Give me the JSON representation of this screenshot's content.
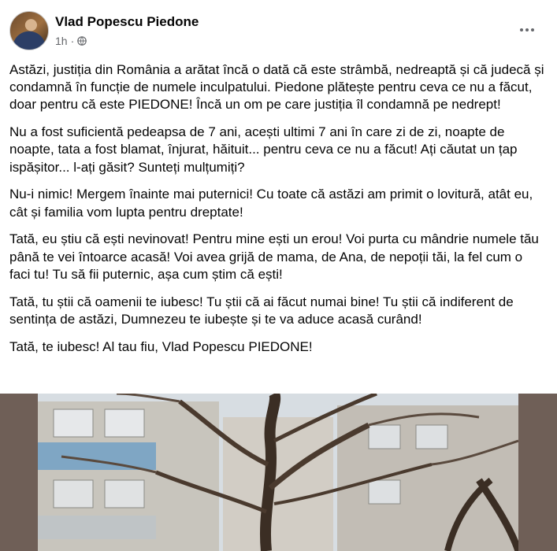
{
  "post": {
    "author": "Vlad Popescu Piedone",
    "time": "1h",
    "meta_separator": "·",
    "paragraphs": [
      "Astăzi, justiția din România a arătat încă o dată că este strâmbă, nedreaptă și că judecă și condamnă în funcție de numele inculpatului. Piedone plătește pentru ceva ce nu a făcut, doar pentru că este PIEDONE! Încă un om pe care justiția îl condamnă pe nedrept!",
      "Nu a fost suficientă pedeapsa de 7 ani, acești ultimi 7 ani în care zi de zi, noapte de noapte, tata a fost blamat, înjurat, hăituit... pentru ceva ce nu a făcut! Ați căutat un țap ispășitor... l-ați găsit? Sunteți mulțumiți?",
      "Nu-i nimic! Mergem înainte mai puternici! Cu toate că astăzi am primit o lovitură, atât eu, cât și familia vom lupta pentru dreptate!",
      "Tată, eu știu că ești nevinovat! Pentru mine ești un erou! Voi purta cu mândrie numele tău până te vei întoarce acasă! Voi avea grijă de mama, de Ana, de nepoții tăi, la fel cum o faci tu! Tu să fii puternic, așa cum știm că ești!",
      "Tată, tu știi că oamenii te iubesc! Tu știi că ai făcut numai bine! Tu știi că indiferent de sentința de astăzi, Dumnezeu te iubește și te va aduce acasă curând!",
      "Tată, te iubesc! Al tau fiu, Vlad Popescu PIEDONE!"
    ]
  },
  "icons": {
    "avatar": "profile-photo",
    "privacy": "globe-icon",
    "more": "more-options-icon"
  },
  "colors": {
    "text": "#050505",
    "secondary": "#65676b",
    "photo_frame": "#6f5f57"
  }
}
